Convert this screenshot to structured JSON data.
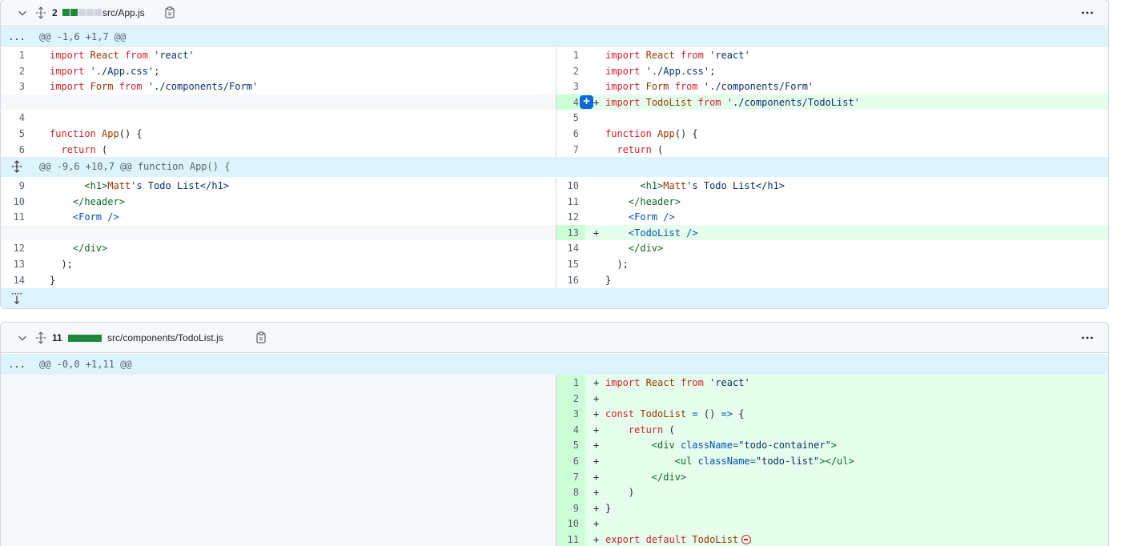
{
  "files": [
    {
      "changes": "2",
      "path": "src/App.js",
      "hunk1": "@@ -1,6 +1,7 @@",
      "hunk2": "@@ -9,6 +10,7 @@ function App() {",
      "expand_label": "...",
      "left_lines": [
        {
          "n": "1",
          "t": "import React from 'react'"
        },
        {
          "n": "2",
          "t": "import './App.css';"
        },
        {
          "n": "3",
          "t": "import Form from './components/Form'"
        },
        {
          "n": "",
          "t": ""
        },
        {
          "n": "4",
          "t": ""
        },
        {
          "n": "5",
          "t": "function App() {"
        },
        {
          "n": "6",
          "t": "  return ("
        },
        {
          "n": "9",
          "t": "      <h1>Matt's Todo List</h1>"
        },
        {
          "n": "10",
          "t": "    </header>"
        },
        {
          "n": "11",
          "t": "    <Form />"
        },
        {
          "n": "",
          "t": ""
        },
        {
          "n": "12",
          "t": "    </div>"
        },
        {
          "n": "13",
          "t": "  );"
        },
        {
          "n": "14",
          "t": "}"
        }
      ],
      "right_lines": [
        {
          "n": "1",
          "t": "import React from 'react'"
        },
        {
          "n": "2",
          "t": "import './App.css';"
        },
        {
          "n": "3",
          "t": "import Form from './components/Form'"
        },
        {
          "n": "4",
          "t": "import TodoList from './components/TodoList'",
          "add": true
        },
        {
          "n": "5",
          "t": ""
        },
        {
          "n": "6",
          "t": "function App() {"
        },
        {
          "n": "7",
          "t": "  return ("
        },
        {
          "n": "10",
          "t": "      <h1>Matt's Todo List</h1>"
        },
        {
          "n": "11",
          "t": "    </header>"
        },
        {
          "n": "12",
          "t": "    <Form />"
        },
        {
          "n": "13",
          "t": "    <TodoList />",
          "add": true
        },
        {
          "n": "14",
          "t": "    </div>"
        },
        {
          "n": "15",
          "t": "  );"
        },
        {
          "n": "16",
          "t": "}"
        }
      ]
    },
    {
      "changes": "11",
      "path": "src/components/TodoList.js",
      "hunk1": "@@ -0,0 +1,11 @@",
      "expand_label": "...",
      "right_lines": [
        {
          "n": "1",
          "t": "import React from 'react'"
        },
        {
          "n": "2",
          "t": ""
        },
        {
          "n": "3",
          "t": "const TodoList = () => {"
        },
        {
          "n": "4",
          "t": "    return ("
        },
        {
          "n": "5",
          "t": "        <div className=\"todo-container\">"
        },
        {
          "n": "6",
          "t": "            <ul className=\"todo-list\"></ul>"
        },
        {
          "n": "7",
          "t": "        </div>"
        },
        {
          "n": "8",
          "t": "    )"
        },
        {
          "n": "9",
          "t": "}"
        },
        {
          "n": "10",
          "t": ""
        },
        {
          "n": "11",
          "t": "export default TodoList"
        }
      ]
    }
  ],
  "add_sign": "+",
  "icons": {
    "collapse": "chevron-down-icon",
    "expand_file": "unfold-icon",
    "copy": "copy-icon",
    "more": "kebab-horizontal-icon",
    "expand_down": "fold-down-icon",
    "add_comment": "plus-icon",
    "no_newline": "no-entry-icon"
  },
  "colors": {
    "added_bg": "#e6ffec",
    "added_gutter": "#ccffd8",
    "hunk_bg": "#ddf4ff",
    "diffstat_add": "#1f883d",
    "diffstat_neutral": "#d0d7de"
  }
}
